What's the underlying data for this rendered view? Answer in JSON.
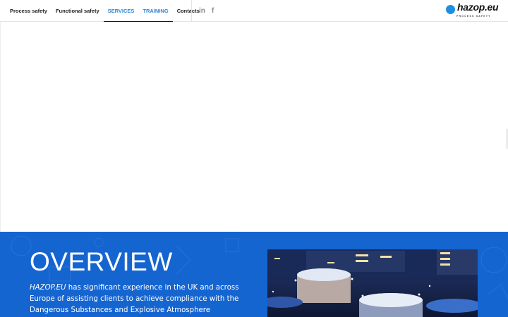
{
  "nav": {
    "items": [
      {
        "label": "Process safety"
      },
      {
        "label": "Functional safety"
      },
      {
        "label": "SERVICES"
      },
      {
        "label": "TRAINING"
      },
      {
        "label": "Contacts"
      }
    ]
  },
  "social": {
    "linkedin": "in",
    "facebook": "f"
  },
  "logo": {
    "text": "hazop.eu",
    "tagline": "PROCESS SAFETY"
  },
  "overview": {
    "title": "OVERVIEW",
    "brand": "HAZOP.EU",
    "text": " has significant experience in the UK and across Europe of assisting clients to achieve compliance with the Dangerous Substances and Explosive Atmosphere Regulations"
  },
  "colors": {
    "accent": "#1565d1",
    "link": "#2f87d6",
    "logo_dot": "#1c8fe0"
  }
}
